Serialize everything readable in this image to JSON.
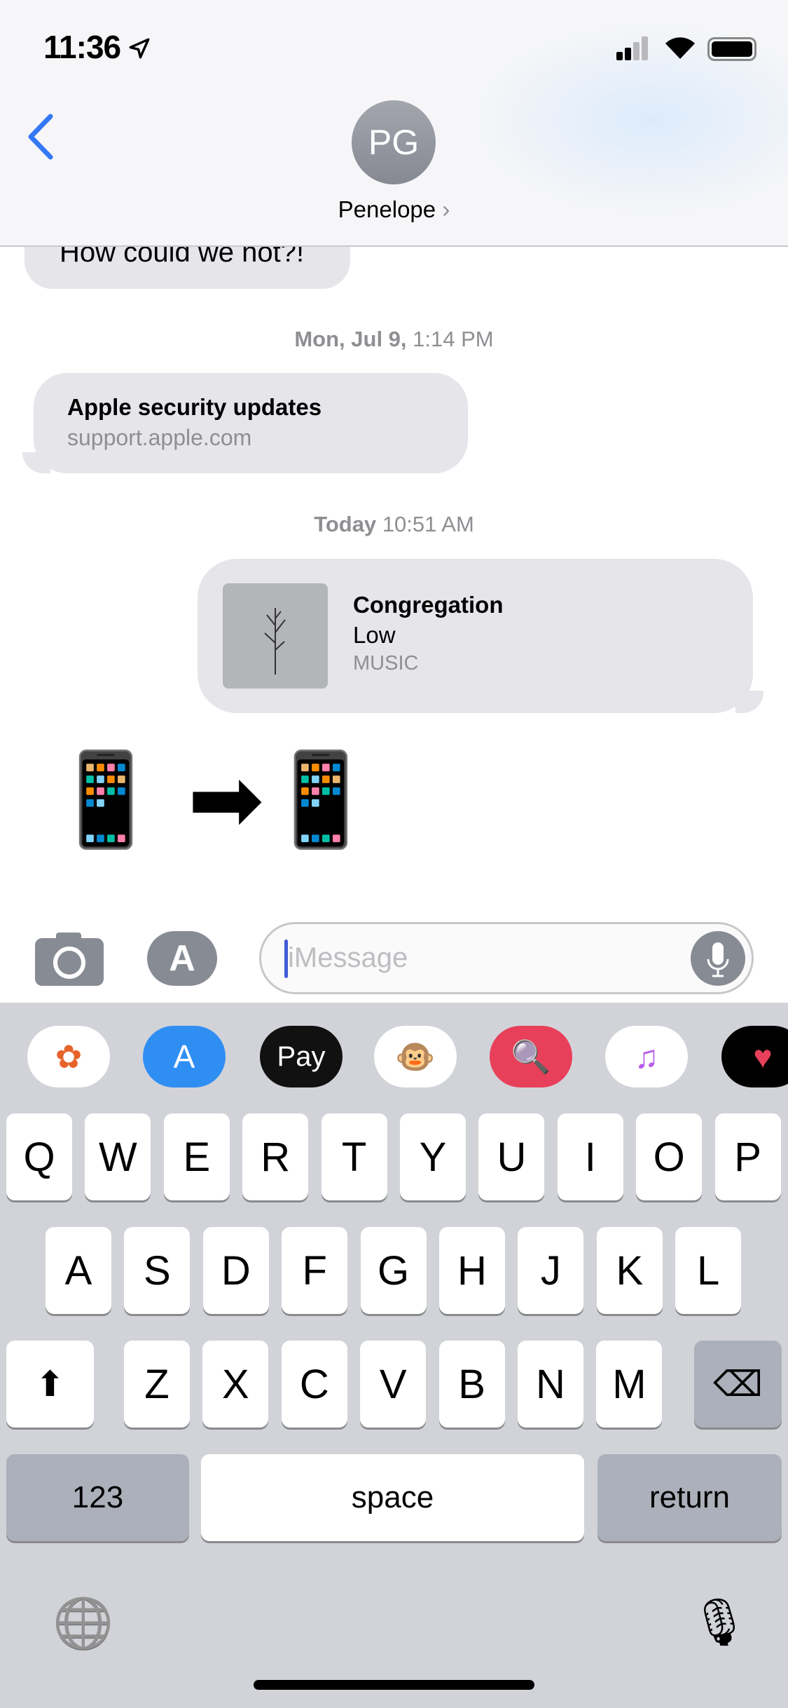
{
  "status_bar": {
    "time": "11:36",
    "location_icon": "location-arrow-icon",
    "signal_bars": 2,
    "wifi": true,
    "battery_level": 1.0
  },
  "header": {
    "contact_initials": "PG",
    "contact_name": "Penelope",
    "chevron": "›",
    "back_icon": "chevron-left-icon"
  },
  "messages": {
    "partial_received": "How could we not?!",
    "stamp1_day": "Mon, Jul 9,",
    "stamp1_time": "1:14 PM",
    "link": {
      "title": "Apple security updates",
      "domain": "support.apple.com",
      "icon": ""
    },
    "stamp2_day": "Today",
    "stamp2_time": "10:51 AM",
    "music": {
      "title": "Congregation",
      "artist": "Low",
      "service": "MUSIC",
      "service_logo": ""
    },
    "emoji": "📱 ➡📱"
  },
  "input": {
    "placeholder": "iMessage",
    "camera_icon": "camera-icon",
    "apps_icon": "app-store-icon",
    "mic_icon": "microphone-icon"
  },
  "app_drawer": [
    {
      "name": "photos",
      "glyph": "✿",
      "bg": "#ffffff",
      "fg": "#e8632b"
    },
    {
      "name": "app-store",
      "glyph": "A",
      "bg": "#2f8ef2",
      "fg": "#ffffff"
    },
    {
      "name": "apple-pay",
      "glyph": "Pay",
      "bg": "#111111",
      "fg": "#ffffff"
    },
    {
      "name": "animoji",
      "glyph": "🐵",
      "bg": "#ffffff",
      "fg": "#000000"
    },
    {
      "name": "web-search",
      "glyph": "🔍",
      "bg": "#e8405a",
      "fg": "#ffffff"
    },
    {
      "name": "music",
      "glyph": "♫",
      "bg": "#ffffff",
      "fg": "#b85be8"
    },
    {
      "name": "digital-touch",
      "glyph": "♥",
      "bg": "#000000",
      "fg": "#e8405a"
    }
  ],
  "keyboard": {
    "row1": [
      "Q",
      "W",
      "E",
      "R",
      "T",
      "Y",
      "U",
      "I",
      "O",
      "P"
    ],
    "row2": [
      "A",
      "S",
      "D",
      "F",
      "G",
      "H",
      "J",
      "K",
      "L"
    ],
    "row3": [
      "Z",
      "X",
      "C",
      "V",
      "B",
      "N",
      "M"
    ],
    "shift": "⬆",
    "delete": "⌫",
    "numbers": "123",
    "space": "space",
    "return": "return",
    "globe": "🌐",
    "dictation": "🎙"
  },
  "colors": {
    "accent": "#3478f6",
    "bubble": "#e5e5ea",
    "keyboard_bg": "#d1d3d9"
  }
}
